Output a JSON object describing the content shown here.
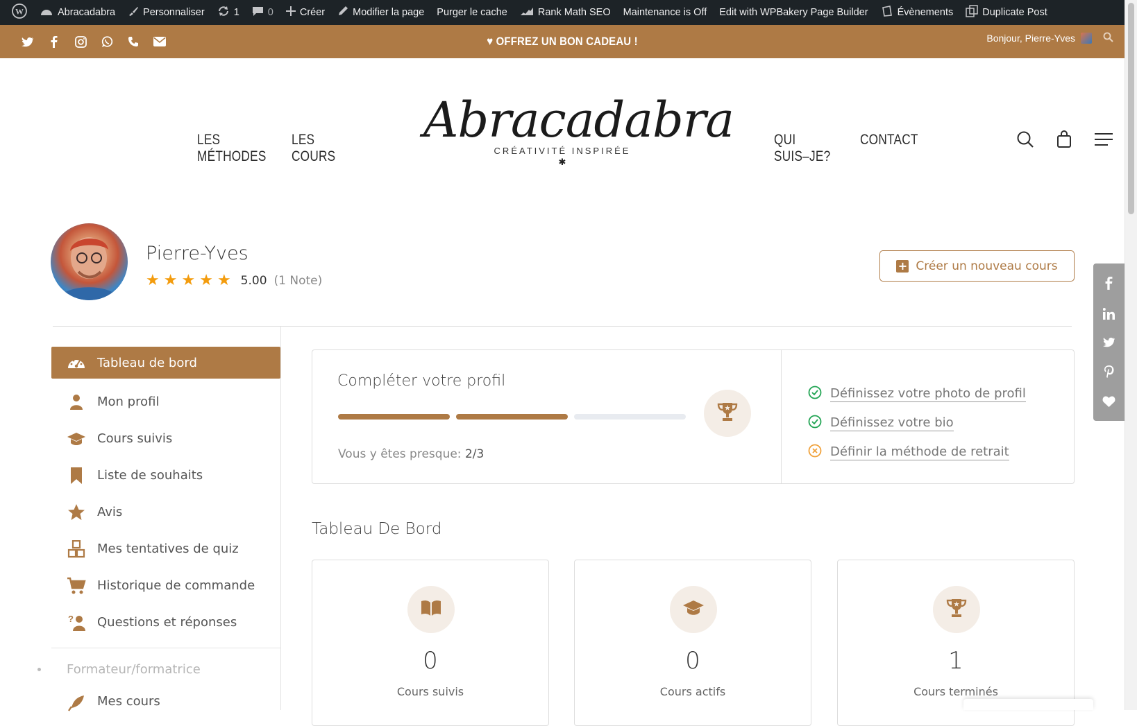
{
  "admin_bar": {
    "wp_icon": "wordpress-icon",
    "site_name": "Abracadabra",
    "customize": "Personnaliser",
    "updates_count": "1",
    "comments_count": "0",
    "new": "Créer",
    "edit_page": "Modifier la page",
    "purge_cache": "Purger le cache",
    "rank_math": "Rank Math SEO",
    "maintenance": "Maintenance is Off",
    "wpbakery": "Edit with WPBakery Page Builder",
    "events": "Évènements",
    "duplicate": "Duplicate Post"
  },
  "top_bar": {
    "promo": "♥ OFFREZ UN BON CADEAU !",
    "greeting": "Bonjour, Pierre-Yves",
    "social_icons": [
      "twitter-icon",
      "facebook-icon",
      "instagram-icon",
      "whatsapp-icon",
      "phone-icon",
      "email-icon"
    ],
    "background": "#ae7a45"
  },
  "header": {
    "nav_left": [
      "LES MÉTHODES",
      "LES COURS"
    ],
    "nav_right": [
      "QUI SUIS–JE?",
      "CONTACT"
    ],
    "logo_text": "Abracadabra",
    "logo_tagline": "CRÉATIVITÉ INSPIRÉE",
    "logo_star": "✱"
  },
  "profile": {
    "name": "Pierre-Yves",
    "rating_value": "5.00",
    "rating_count": "(1 Note)",
    "stars": 5,
    "create_course": "Créer un nouveau cours"
  },
  "sidebar": {
    "items": [
      {
        "label": "Tableau de bord",
        "icon": "dashboard-icon",
        "active": true
      },
      {
        "label": "Mon profil",
        "icon": "user-icon"
      },
      {
        "label": "Cours suivis",
        "icon": "graduation-cap-icon"
      },
      {
        "label": "Liste de souhaits",
        "icon": "bookmark-icon"
      },
      {
        "label": "Avis",
        "icon": "star-icon"
      },
      {
        "label": "Mes tentatives de quiz",
        "icon": "quiz-blocks-icon"
      },
      {
        "label": "Historique de commande",
        "icon": "cart-icon"
      },
      {
        "label": "Questions et réponses",
        "icon": "question-icon"
      }
    ],
    "group_label": "Formateur/formatrice",
    "group_items": [
      {
        "label": "Mes cours",
        "icon": "rocket-icon"
      }
    ]
  },
  "profile_completion": {
    "title": "Compléter votre profil",
    "status_prefix": "Vous y êtes presque:",
    "status_value": "2/3",
    "steps_total": 3,
    "steps_done": 2,
    "checklist": [
      {
        "label": "Définissez votre photo de profil",
        "done": true
      },
      {
        "label": "Définissez votre bio",
        "done": true
      },
      {
        "label": "Définir la méthode de retrait",
        "done": false
      }
    ]
  },
  "dashboard": {
    "title": "Tableau De Bord",
    "stats": [
      {
        "value": "0",
        "label": "Cours suivis",
        "icon": "open-book-icon"
      },
      {
        "value": "0",
        "label": "Cours actifs",
        "icon": "graduation-cap-icon"
      },
      {
        "value": "1",
        "label": "Cours terminés",
        "icon": "trophy-icon"
      }
    ]
  },
  "share_bar": [
    "facebook-icon",
    "linkedin-icon",
    "twitter-icon",
    "pinterest-icon",
    "heart-icon"
  ]
}
